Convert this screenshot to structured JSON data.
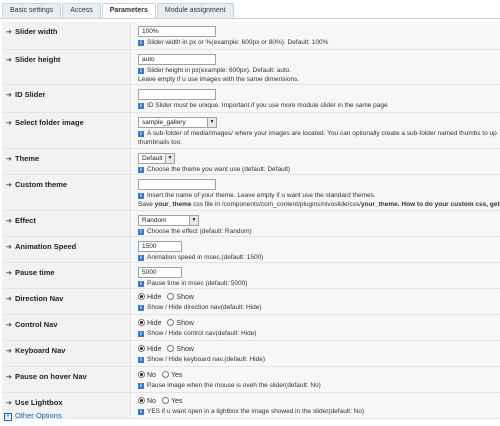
{
  "tabs": [
    "Basic settings",
    "Access",
    "Parameters",
    "Module assignment"
  ],
  "active_tab": "Parameters",
  "params": {
    "slider_width": {
      "label": "Slider width",
      "value": "100%",
      "help": "Slider width in px or %(example: 600px or 80%). Default: 100%"
    },
    "slider_height": {
      "label": "Slider height",
      "value": "auto",
      "help": "Slider height in px(example: 600px). Default: auto.",
      "help2": "Leave empty if u use images with the same dimensions."
    },
    "id_slider": {
      "label": "ID Slider",
      "value": "",
      "help": "ID Slider must be unique. Important if you use more module slider in the same page"
    },
    "folder": {
      "label": "Select folder image",
      "value": "sample_gallery",
      "help": "A sub-folder of media/images/ where your images are located. You can optionally create a sub-folder named thumbs to up",
      "help2": "thumbnails too."
    },
    "theme": {
      "label": "Theme",
      "value": "Default",
      "help": "Choose the theme you want use (default: Default)"
    },
    "custom_theme": {
      "label": "Custom theme",
      "value": "",
      "help": "Insert the name of your theme. Leave empty if u want use the standard themes.",
      "help2_a": "Save ",
      "help2_b": "your_theme",
      "help2_c": " css file in /components/com_content/plugins/nivoslide/css/",
      "help2_d": "your_theme.",
      "help2_e": " How to do your custom css, get"
    },
    "effect": {
      "label": "Effect",
      "value": "Random",
      "help": "Choose the effect (default: Random)"
    },
    "anim_speed": {
      "label": "Animation Speed",
      "value": "1500",
      "help": "Animation speed in msec.(default: 1500)"
    },
    "pause_time": {
      "label": "Pause time",
      "value": "5000",
      "help": "Pause time in msec (default: 5000)"
    },
    "direction_nav": {
      "label": "Direction Nav",
      "opt1": "Hide",
      "opt2": "Show",
      "help": "Show / Hide direction nav(default: Hide)"
    },
    "control_nav": {
      "label": "Control Nav",
      "opt1": "Hide",
      "opt2": "Show",
      "help": "Show / Hide control nav(default: Hide)"
    },
    "keyboard_nav": {
      "label": "Keyboard Nav",
      "opt1": "Hide",
      "opt2": "Show",
      "help": "Show / Hide keyboard nav.(default: Hide)"
    },
    "pause_hover": {
      "label": "Pause on hover Nav",
      "opt1": "No",
      "opt2": "Yes",
      "help": "Pause image when the mouse is oveh the slider(default: No)"
    },
    "lightbox": {
      "label": "Use Lightbox",
      "opt1": "No",
      "opt2": "Yes",
      "help": "YES if u want open in a lightbox the image showed in the slider(default: No)"
    }
  },
  "other_options": "Other Options",
  "icons": {
    "row_arrow": "arrow-right-icon",
    "info": "info-icon",
    "expand": "plus-icon"
  },
  "colors": {
    "accent": "#1a5fb4",
    "info": "#3a7bc8"
  }
}
